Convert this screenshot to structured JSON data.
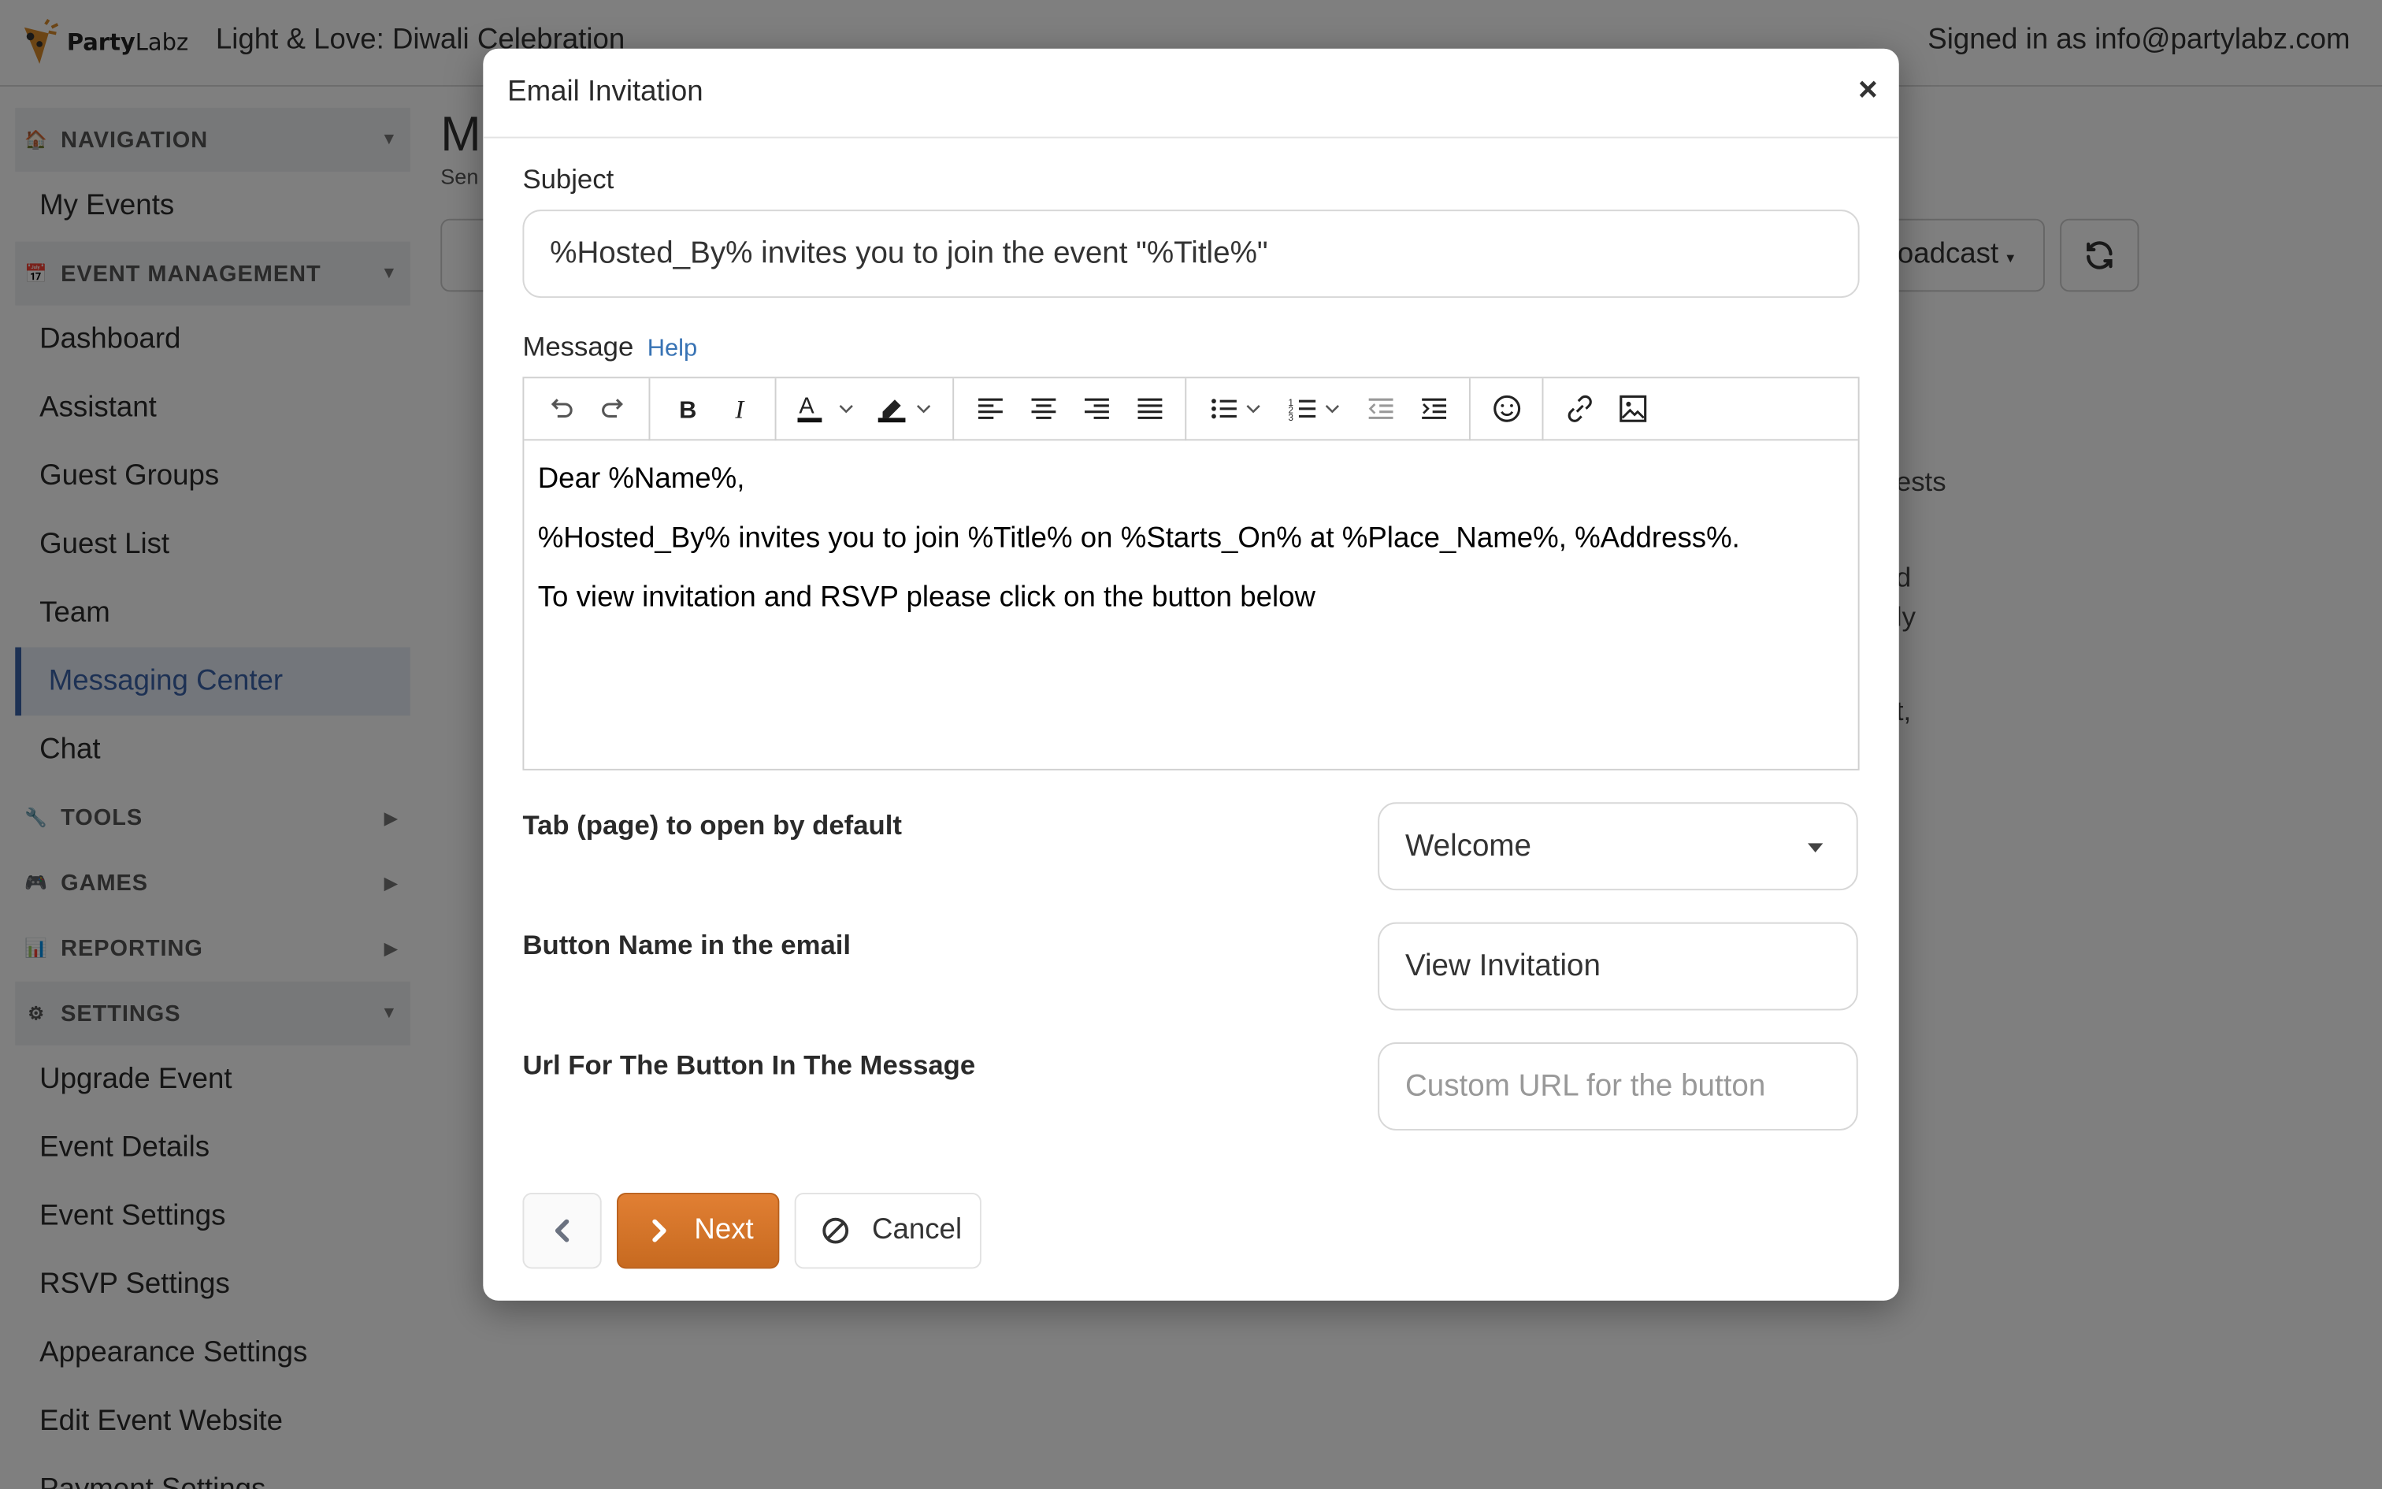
{
  "topbar": {
    "brand_bold": "Party",
    "brand_light": "Labz",
    "event_title": "Light & Love: Diwali Celebration",
    "signed_in": "Signed in as info@partylabz.com"
  },
  "sidebar": {
    "sections": [
      {
        "label": "NAVIGATION",
        "icon": "house-icon"
      },
      {
        "label": "EVENT MANAGEMENT",
        "icon": "calendar-icon"
      },
      {
        "label": "TOOLS",
        "icon": "wrench-icon"
      },
      {
        "label": "GAMES",
        "icon": "gamepad-icon"
      },
      {
        "label": "REPORTING",
        "icon": "bar-chart-icon"
      },
      {
        "label": "SETTINGS",
        "icon": "gear-icon"
      }
    ],
    "nav_items": {
      "my_events": "My Events",
      "dashboard": "Dashboard",
      "assistant": "Assistant",
      "guest_groups": "Guest Groups",
      "guest_list": "Guest List",
      "team": "Team",
      "messaging_center": "Messaging Center",
      "chat": "Chat",
      "upgrade_event": "Upgrade Event",
      "event_details": "Event Details",
      "event_settings": "Event Settings",
      "rsvp_settings": "RSVP Settings",
      "appearance_settings": "Appearance Settings",
      "edit_event_website": "Edit Event Website",
      "payment_settings": "Payment Settings"
    }
  },
  "background": {
    "heading_fragment": "M",
    "sub_fragment": "Sen",
    "broadcast_fragment": "oadcast",
    "frag_1": "ests",
    "frag_2": "d",
    "frag_3": "ly",
    "frag_4": "t,"
  },
  "modal": {
    "title": "Email Invitation",
    "close": "×",
    "subject_label": "Subject",
    "subject_value": "%Hosted_By% invites you to join the event \"%Title%\"",
    "message_label": "Message",
    "help_link": "Help",
    "message_lines": [
      "Dear %Name%,",
      "%Hosted_By% invites you to join %Title% on %Starts_On% at %Place_Name%, %Address%.",
      "To view invitation and RSVP please click on the button below"
    ],
    "tab_label": "Tab (page) to open by default",
    "tab_value": "Welcome",
    "button_name_label": "Button Name in the email",
    "button_name_value": "View Invitation",
    "url_label": "Url For The Button In The Message",
    "url_placeholder": "Custom URL for the button",
    "next_label": "Next",
    "cancel_label": "Cancel"
  },
  "colors": {
    "accent_orange": "#d4732a",
    "link_blue": "#3873b4",
    "active_nav": "#3b63a8"
  }
}
